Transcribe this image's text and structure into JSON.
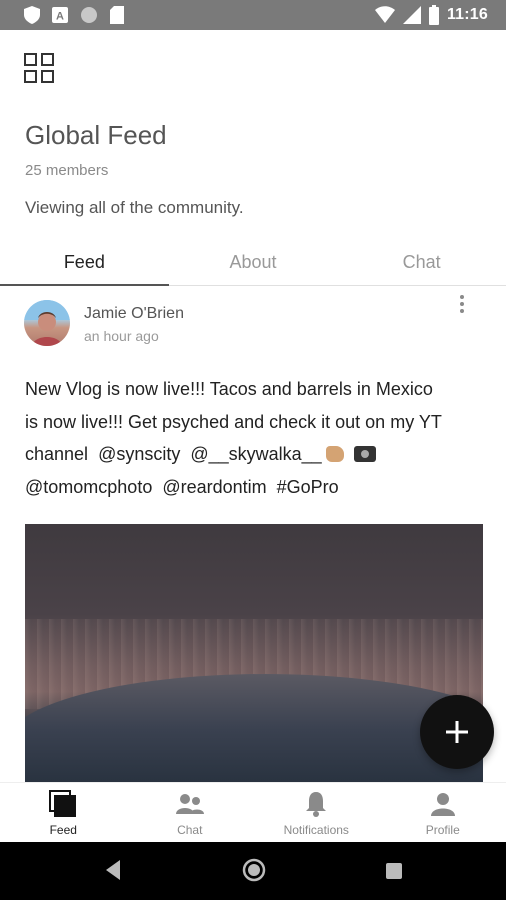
{
  "status_bar": {
    "time": "11:16",
    "icons": [
      "shield-icon",
      "a-icon",
      "circle-icon",
      "sd-card-icon",
      "wifi-icon",
      "signal-icon",
      "battery-icon"
    ]
  },
  "header": {
    "menu_icon": "grid-icon",
    "title": "Global Feed",
    "members": "25 members",
    "description": "Viewing all of the community."
  },
  "tabs": [
    {
      "label": "Feed",
      "active": true
    },
    {
      "label": "About",
      "active": false
    },
    {
      "label": "Chat",
      "active": false
    }
  ],
  "post": {
    "author": "Jamie O'Brien",
    "time": "an hour ago",
    "lines": [
      "New Vlog is now live!!! Tacos and barrels in Mexico",
      "is now live!!! Get psyched and check it out on my YT"
    ],
    "line3_prefix": "channel",
    "mentions_line3": [
      "@synscity",
      "@__skywalka__"
    ],
    "mentions_line4": [
      "@tomomcphoto",
      "@reardontim",
      "#GoPro"
    ],
    "emoji": [
      "hand-emoji",
      "camera-emoji"
    ]
  },
  "fab": {
    "icon": "plus-icon"
  },
  "bottom_nav": [
    {
      "label": "Feed",
      "icon": "feed-icon",
      "active": true
    },
    {
      "label": "Chat",
      "icon": "chat-icon",
      "active": false
    },
    {
      "label": "Notifications",
      "icon": "bell-icon",
      "active": false
    },
    {
      "label": "Profile",
      "icon": "profile-icon",
      "active": false
    }
  ],
  "colors": {
    "status_bar": "#7a7a7a",
    "fab": "#111111",
    "active_tab_indicator": "#555555"
  }
}
